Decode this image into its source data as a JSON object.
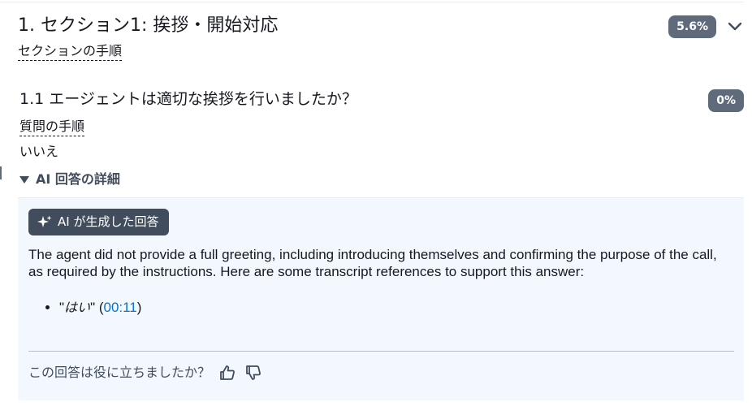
{
  "section": {
    "title": "1. セクション1: 挨拶・開始対応",
    "score_badge": "5.6%",
    "instructions_link": "セクションの手順"
  },
  "question": {
    "title": "1.1 エージェントは適切な挨拶を行いましたか？",
    "score_badge": "0%",
    "instructions_link": "質問の手順",
    "answer": "いいえ"
  },
  "ai_details": {
    "toggle_label": "AI 回答の詳細",
    "chip_label": "AI が生成した回答",
    "explanation": "The agent did not provide a full greeting, including introducing themselves and confirming the purpose of the call, as required by the instructions. Here are some transcript references to support this answer:",
    "references": [
      {
        "quote": "はい",
        "timestamp": "00:11"
      }
    ],
    "feedback_prompt": "この回答は役に立ちましたか？"
  },
  "icons": {
    "expand": "chevron-down-icon",
    "sparkle": "sparkle-icon",
    "thumbs_up": "thumbs-up-icon",
    "thumbs_down": "thumbs-down-icon"
  },
  "colors": {
    "badge_bg": "#5f6b7a",
    "chip_bg": "#414d5c",
    "panel_bg": "#f2f8fd",
    "link": "#0972d3"
  }
}
